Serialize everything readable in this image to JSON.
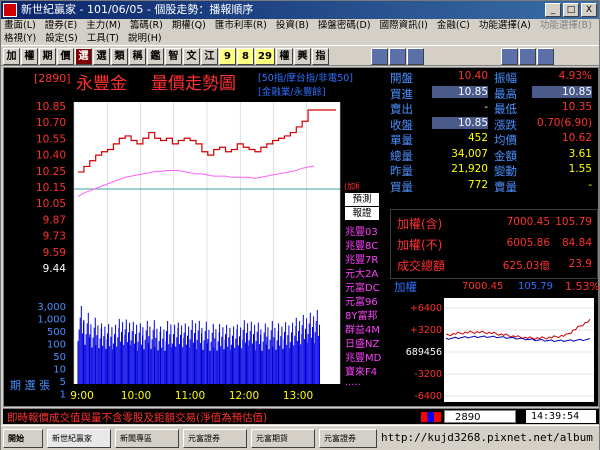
{
  "window": {
    "title": "新世紀贏家 - 101/06/05 - 個股走勢：播報順序",
    "buttons": [
      "_",
      "□",
      "X"
    ]
  },
  "menu1": [
    "畫面(L)",
    "證券(E)",
    "主力(M)",
    "籌碼(R)",
    "期權(Q)",
    "匯市利率(R)",
    "投資(B)",
    "操盤密碼(D)",
    "國際資訊(I)",
    "金融(C)",
    "功能選擇(A)",
    "功能選擇(B)"
  ],
  "menu2": [
    "格視(Y)",
    "設定(S)",
    "工具(T)",
    "說明(H)"
  ],
  "toolbar": [
    "加",
    "權",
    "期",
    "價",
    "選",
    "選",
    "類",
    "稱",
    "鑑",
    "智",
    "文",
    "江",
    "9",
    "8",
    "29",
    "權",
    "興",
    "指"
  ],
  "header": {
    "code": "[2890]",
    "name": "永豐金",
    "chart_title": "量價走勢圖",
    "index_info": "[50指/摩台指/非電50]",
    "sector_info": "[金融業/永豐餘]"
  },
  "quote": {
    "rows": [
      {
        "l1": "開盤",
        "v1": "10.40",
        "l2": "振幅",
        "v2": "4.93%",
        "c1": "#ff3030",
        "c2": "#ff3030"
      },
      {
        "l1": "買進",
        "v1": "10.85",
        "l2": "最高",
        "v2": "10.85",
        "c1": "#ffffff",
        "c2": "#ffffff",
        "box1": true,
        "box2": true
      },
      {
        "l1": "賣出",
        "v1": "-",
        "l2": "最低",
        "v2": "10.35",
        "c1": "#ffffff",
        "c2": "#ff3030"
      },
      {
        "l1": "收盤",
        "v1": "10.85",
        "l2": "漲跌",
        "v2": "0.70(6.90)",
        "c1": "#ffffff",
        "c2": "#ff3030",
        "box1": true
      },
      {
        "l1": "單量",
        "v1": "452",
        "l2": "均價",
        "v2": "10.62",
        "c1": "#ffff00",
        "c2": "#ff3030"
      },
      {
        "l1": "總量",
        "v1": "34,007",
        "l2": "金額",
        "v2": "3.61",
        "c1": "#ffff00",
        "c2": "#ffff00"
      },
      {
        "l1": "昨量",
        "v1": "21,920",
        "l2": "變動",
        "v2": "1.55",
        "c1": "#ffff00",
        "c2": "#ffff00"
      },
      {
        "l1": "買量",
        "v1": "772",
        "l2": "賣量",
        "v2": "-",
        "c1": "#ffff00",
        "c2": "#ffff00"
      }
    ]
  },
  "index": {
    "rows": [
      {
        "label": "加權(含)",
        "value": "7000.45",
        "change": "105.79"
      },
      {
        "label": "加權(不)",
        "value": "6005.86",
        "change": "84.84"
      },
      {
        "label": "成交總額",
        "value": "625.03億",
        "change": "23.9"
      }
    ]
  },
  "mini": {
    "label": "加權",
    "value": "7000.45",
    "change": "105.79",
    "pct": "1.53%",
    "ticks": [
      "+6400",
      "+3200",
      "689456",
      "-3200",
      "-6400"
    ]
  },
  "brokers": {
    "tabs": [
      "預測",
      "報證"
    ],
    "items": [
      "兆豐03",
      "兆豐8C",
      "兆豐7R",
      "元大2A",
      "元富DC",
      "元富96",
      "8Y富邦",
      "群益4M",
      "日盛NZ",
      "兆豐MD",
      "寶來F4",
      "....."
    ]
  },
  "chart_data": {
    "type": "line",
    "price_ticks": [
      "10.85",
      "10.70",
      "10.55",
      "10.40",
      "10.25",
      "10.15",
      "10.05",
      "9.87",
      "9.73",
      "9.59",
      "9.44"
    ],
    "volume_ticks": [
      "3,000",
      "1,000",
      "500",
      "100",
      "50",
      "10",
      "5",
      "1"
    ],
    "x_ticks": [
      "9:00",
      "10:00",
      "11:00",
      "12:00",
      "13:00"
    ],
    "ref_price": "10.15",
    "unit_label": "(加權)",
    "side_label": "期 選 張",
    "price": [
      10.3,
      10.35,
      10.4,
      10.45,
      10.48,
      10.5,
      10.55,
      10.6,
      10.62,
      10.58,
      10.55,
      10.6,
      10.65,
      10.6,
      10.58,
      10.6,
      10.55,
      10.58,
      10.6,
      10.58,
      10.55,
      10.48,
      10.45,
      10.5,
      10.52,
      10.48,
      10.5,
      10.55,
      10.52,
      10.5,
      10.48,
      10.52,
      10.55,
      10.58,
      10.6,
      10.62,
      10.65,
      10.7,
      10.75,
      10.85,
      10.85
    ],
    "avg": [
      10.35,
      10.38,
      10.4,
      10.42,
      10.44,
      10.46,
      10.48,
      10.5,
      10.52,
      10.53,
      10.54,
      10.55,
      10.56,
      10.57,
      10.57,
      10.58,
      10.58,
      10.58,
      10.57,
      10.56,
      10.55,
      10.55,
      10.54,
      10.53,
      10.53,
      10.53,
      10.52,
      10.52,
      10.52,
      10.52,
      10.51,
      10.52,
      10.53,
      10.54,
      10.55,
      10.56,
      10.57,
      10.58,
      10.6,
      10.61,
      10.62
    ],
    "volume": [
      3000,
      1500,
      900,
      800,
      700,
      650,
      600,
      800,
      750,
      600,
      500,
      650,
      700,
      550,
      500,
      900,
      600,
      550,
      500,
      700,
      650,
      600,
      480,
      520,
      650,
      600,
      500,
      450,
      700,
      600,
      550,
      500,
      650,
      600,
      700,
      800,
      750,
      900,
      1200,
      1500,
      2000
    ]
  },
  "bottom": {
    "notice": "即時報價成交值與量不含零股及鉅額交易(淨值為預估值)",
    "code": "2890",
    "time": "14:39:54"
  },
  "taskbar": [
    "開始",
    "新世紀贏家",
    "新聞專區",
    "元富證券",
    "元富期貨",
    "元富證券",
    "http://kujd3268.pixnet.net/album"
  ]
}
